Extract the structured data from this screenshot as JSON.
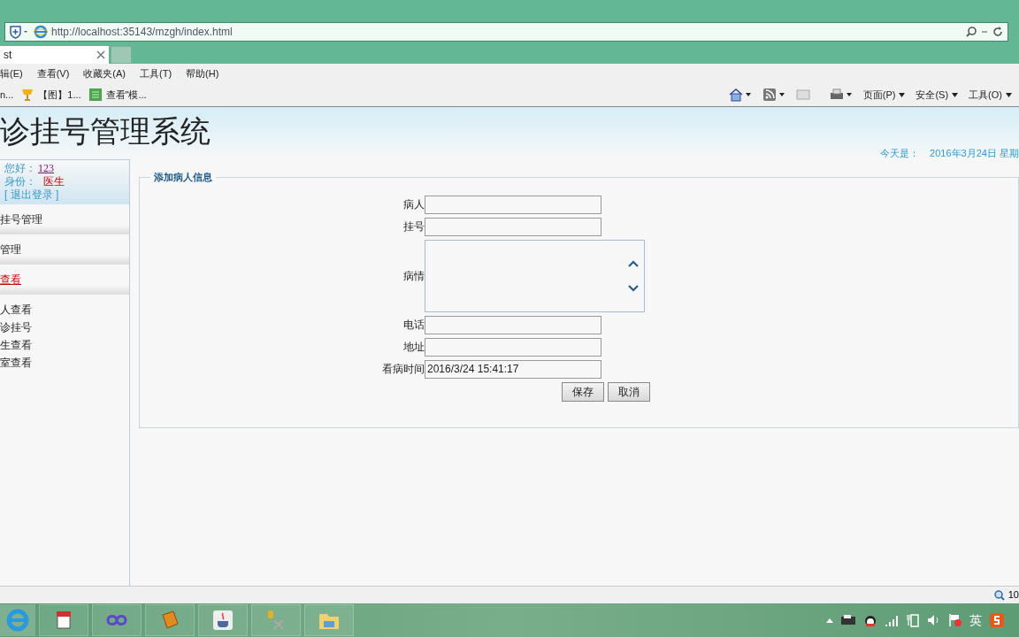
{
  "browser": {
    "address": "http://localhost:35143/mzgh/index.html",
    "tabs": [
      {
        "label": "st",
        "selected": true
      },
      {
        "selected": false
      }
    ],
    "menu": [
      "辑(E)",
      "查看(V)",
      "收藏夹(A)",
      "工具(T)",
      "帮助(H)"
    ],
    "favorites": [
      "n...",
      "【图】1...",
      "查看\"模..."
    ],
    "commands": [
      "页面(P)",
      "安全(S)",
      "工具(O)"
    ],
    "zoom": "10"
  },
  "header": {
    "title": "诊挂号管理系统",
    "date_label": "今天是：",
    "date": "2016年3月24日 星期"
  },
  "user": {
    "greeting": "您好：",
    "name": "123",
    "role_label": "身份：",
    "role": "医生",
    "logout": "[ 退出登录 ]"
  },
  "sidebar": {
    "sections": [
      {
        "label": "挂号管理",
        "selected": false
      },
      {
        "label": "管理",
        "selected": false
      },
      {
        "label": "查看",
        "selected": true
      }
    ],
    "items": [
      "人查看",
      "诊挂号",
      "生查看",
      "室查看"
    ]
  },
  "form": {
    "legend": "添加病人信息",
    "fields": [
      {
        "label": "病人",
        "kind": "input"
      },
      {
        "label": "挂号",
        "kind": "input"
      },
      {
        "label": "病情",
        "kind": "textarea"
      },
      {
        "label": "电话",
        "kind": "input"
      },
      {
        "label": "地址",
        "kind": "input"
      },
      {
        "label": "看病时间",
        "kind": "input",
        "value": "2016/3/24 15:41:17"
      }
    ],
    "buttons": [
      "保存",
      "取消"
    ]
  },
  "taskbar": {
    "tray_language": "英"
  }
}
